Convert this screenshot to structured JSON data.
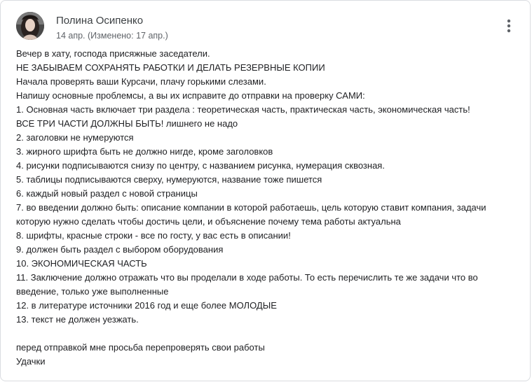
{
  "post": {
    "author_name": "Полина Осипенко",
    "date": "14 апр. (Изменено: 17 апр.)",
    "more_icon": "more-vert-icon",
    "avatar_icon": "user-avatar",
    "lines": [
      "Вечер в хату, господа присяжные заседатели.",
      "НЕ ЗАБЫВАЕМ СОХРАНЯТЬ РАБОТКИ И ДЕЛАТЬ РЕЗЕРВНЫЕ КОПИИ",
      "Начала проверять ваши Курсачи, плачу горькими слезами.",
      "Напишу основные проблемсы, а вы их исправите до отправки на проверку САМИ:",
      "1. Основная часть включает три раздела : теоретическая часть, практическая часть, экономическая часть!",
      "ВСЕ ТРИ ЧАСТИ ДОЛЖНЫ БЫТЬ! лишнего не надо",
      "2. заголовки не нумеруются",
      "3. жирного шрифта быть не должно нигде, кроме заголовков",
      "4. рисунки подписываются снизу по центру, с названием рисунка, нумерация сквозная.",
      "5. таблицы подписываются сверху, нумеруются, название тоже пишется",
      "6. каждый новый раздел с новой страницы",
      "7. во введении должно быть: описание компании в которой работаешь, цель которую ставит компания, задачи",
      "которую нужно сделать чтобы достичь цели, и объяснение почему тема работы актуальна",
      "8. шрифты, красные строки - все по госту, у вас есть в описании!",
      "9. должен быть раздел с выбором оборудования",
      "10. ЭКОНОМИЧЕСКАЯ ЧАСТЬ",
      "11. Заключение должно отражать что вы проделали в ходе работы. То есть перечислить те же задачи что во",
      "введение, только уже выполненные",
      "12. в литературе источники 2016 год и еще более МОЛОДЫЕ",
      "13. текст не должен уезжать.",
      "",
      "перед отправкой мне просьба перепроверять свои работы",
      "Удачки"
    ]
  }
}
